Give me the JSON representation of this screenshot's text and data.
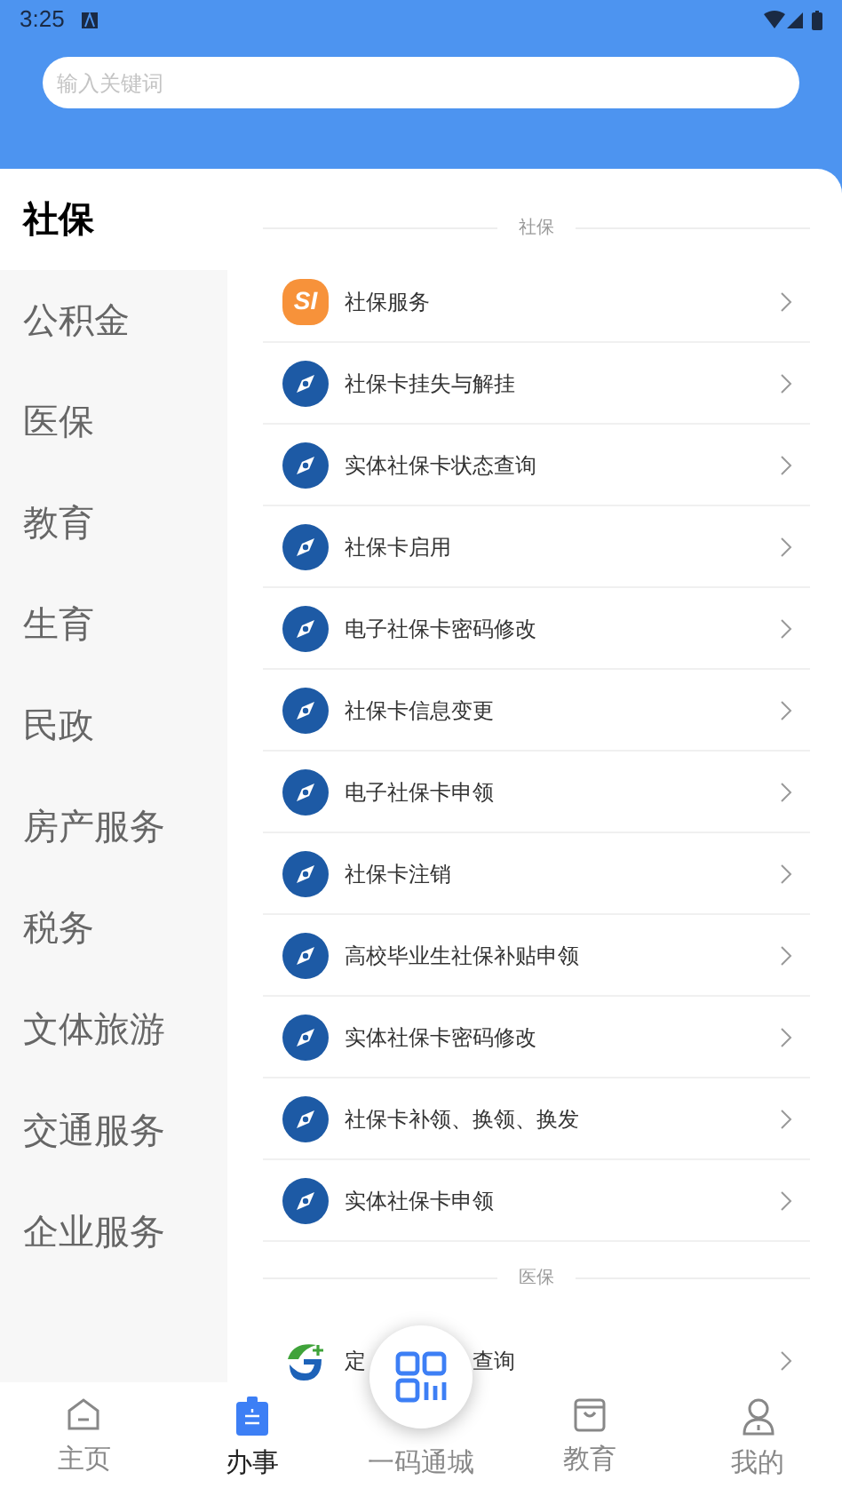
{
  "status_bar": {
    "time": "3:25"
  },
  "search": {
    "placeholder": "输入关键词"
  },
  "sidebar": {
    "items": [
      {
        "label": "社保",
        "selected": true
      },
      {
        "label": "公积金",
        "selected": false
      },
      {
        "label": "医保",
        "selected": false
      },
      {
        "label": "教育",
        "selected": false
      },
      {
        "label": "生育",
        "selected": false
      },
      {
        "label": "民政",
        "selected": false
      },
      {
        "label": "房产服务",
        "selected": false
      },
      {
        "label": "税务",
        "selected": false
      },
      {
        "label": "文体旅游",
        "selected": false
      },
      {
        "label": "交通服务",
        "selected": false
      },
      {
        "label": "企业服务",
        "selected": false
      }
    ]
  },
  "sections": [
    {
      "title": "社保",
      "items": [
        {
          "kind": "si",
          "badge": "SI",
          "label": "社保服务"
        },
        {
          "kind": "compass",
          "label": "社保卡挂失与解挂"
        },
        {
          "kind": "compass",
          "label": "实体社保卡状态查询"
        },
        {
          "kind": "compass",
          "label": "社保卡启用"
        },
        {
          "kind": "compass",
          "label": "电子社保卡密码修改"
        },
        {
          "kind": "compass",
          "label": "社保卡信息变更"
        },
        {
          "kind": "compass",
          "label": "电子社保卡申领"
        },
        {
          "kind": "compass",
          "label": "社保卡注销"
        },
        {
          "kind": "compass",
          "label": "高校毕业生社保补贴申领"
        },
        {
          "kind": "compass",
          "label": "实体社保卡密码修改"
        },
        {
          "kind": "compass",
          "label": "社保卡补领、换领、换发"
        },
        {
          "kind": "compass",
          "label": "实体社保卡申领"
        }
      ]
    },
    {
      "title": "医保",
      "items": [
        {
          "kind": "leaf",
          "label": "定",
          "label_end": "查询"
        }
      ]
    }
  ],
  "bottom_nav": [
    {
      "kind": "home",
      "label": "主页",
      "selected": false
    },
    {
      "kind": "task",
      "label": "办事",
      "selected": true
    },
    {
      "kind": "qr",
      "label": "一码通城",
      "selected": false
    },
    {
      "kind": "bag",
      "label": "教育",
      "selected": false
    },
    {
      "kind": "person",
      "label": "我的",
      "selected": false
    }
  ]
}
